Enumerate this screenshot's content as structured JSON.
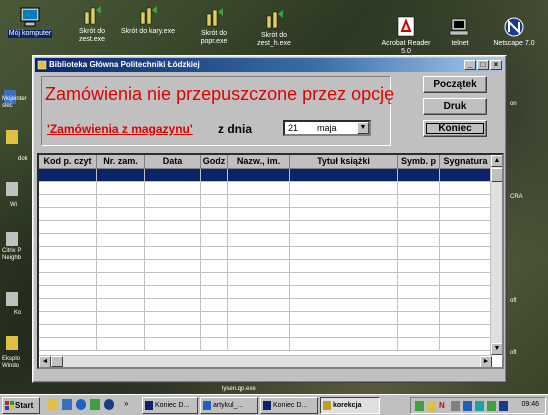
{
  "desktop": {
    "icons": [
      {
        "label": "Mój komputer",
        "selected": true
      },
      {
        "label": "Skrót do zest.exe",
        "selected": false
      },
      {
        "label": "Skrót do kary.exe",
        "selected": false
      },
      {
        "label": "Skrót do popr.exe",
        "selected": false
      },
      {
        "label": "Skrót do zest_h.exe",
        "selected": false
      },
      {
        "label": "Acrobat Reader 5.0",
        "selected": false
      },
      {
        "label": "telnet",
        "selected": false
      },
      {
        "label": "Netscape 7.0",
        "selected": false
      }
    ],
    "side_labels": [
      "Mojeinter siec",
      "dok",
      "Wi",
      "Citrix P Neighb",
      "Ko",
      "Eksplo Windo",
      "on",
      "CRA",
      "oft",
      "oft"
    ],
    "bottom_stub": "lysen.qp.exe"
  },
  "window": {
    "title": "Biblioteka Główna Politechniki Łódzkiej",
    "controls": {
      "minimize": "_",
      "maximize": "□",
      "close": "×"
    },
    "heading": "Zamówienia nie przepuszczone przez opcję",
    "link_label": "'Zamówienia z magazynu'",
    "date_label": "z dnia",
    "date": {
      "day": "21",
      "month": "maja"
    },
    "buttons": {
      "start": "Początek",
      "print": "Druk",
      "end": "Koniec"
    },
    "grid": {
      "columns": [
        "Kod p. czyt",
        "Nr. zam.",
        "Data",
        "Godz",
        "Nazw., im.",
        "Tytuł książki",
        "Symb. p",
        "Sygnatura"
      ],
      "row_count": 14,
      "selected_row": 0
    }
  },
  "taskbar": {
    "start_label": "Start",
    "tasks": [
      {
        "label": "Koniec D...",
        "active": false
      },
      {
        "label": "artykul_...",
        "active": false
      },
      {
        "label": "Koniec D...",
        "active": false
      },
      {
        "label": "korekcja",
        "active": true
      }
    ],
    "overflow": "»",
    "clock": "09:46"
  },
  "colors": {
    "title_bar": "#0a246a",
    "heading": "#e00000",
    "selected_row": "#0a246a",
    "face": "#c0c0c0"
  }
}
